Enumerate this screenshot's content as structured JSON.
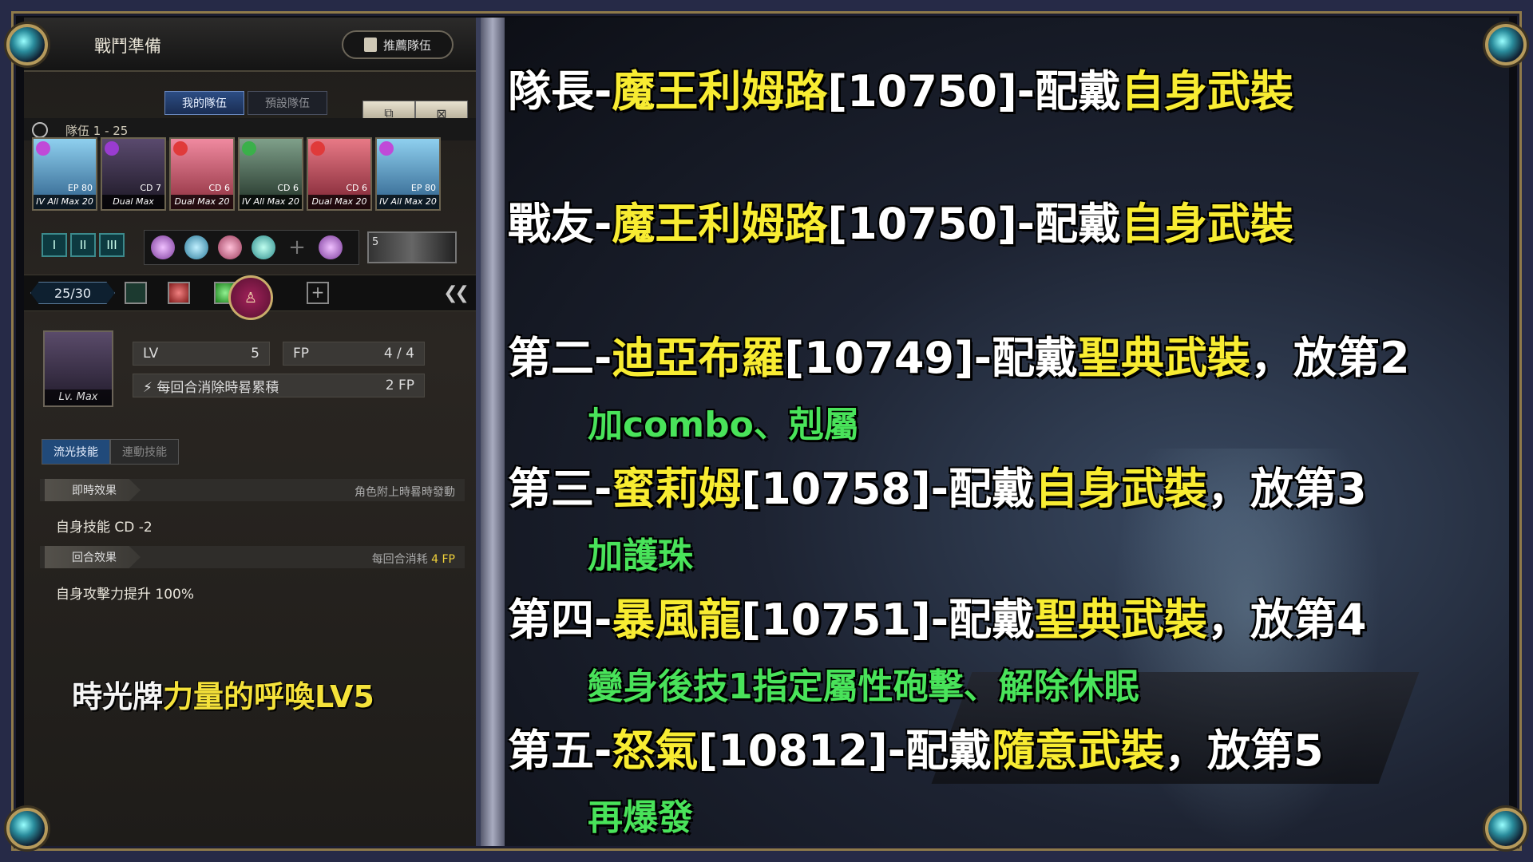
{
  "panel": {
    "title": "戰鬥準備",
    "recommend_button": "推薦隊伍",
    "tabs": [
      "我的隊伍",
      "預設隊伍"
    ],
    "team_label": "隊伍 1 - 25",
    "team_count": "25/30",
    "cards": [
      {
        "tag": "All Max",
        "level": "20",
        "info": "EP 80",
        "tier": "IV",
        "color": "#4a93c8"
      },
      {
        "tag": "Dual Max",
        "level": "",
        "info": "CD 7",
        "tier": "",
        "color": "#3a3246"
      },
      {
        "tag": "Dual Max",
        "level": "20",
        "info": "CD 6",
        "tier": "",
        "color": "#c05a6a"
      },
      {
        "tag": "All Max",
        "level": "20",
        "info": "CD 6",
        "tier": "IV",
        "color": "#3c5a48"
      },
      {
        "tag": "Dual Max",
        "level": "20",
        "info": "CD 6",
        "tier": "",
        "color": "#b84a55"
      },
      {
        "tag": "All Max",
        "level": "20",
        "info": "EP 80",
        "tier": "IV",
        "color": "#4a93c8"
      }
    ],
    "roman": [
      "I",
      "II",
      "III"
    ],
    "minipic_label": "5",
    "stats": {
      "lv_label": "LV",
      "lv_value": "5",
      "fp_label": "FP",
      "fp_value": "4 / 4",
      "passive": "每回合消除時晷累積",
      "passive_cost": "2 FP"
    },
    "portrait_label": "Lv. Max",
    "skill_tabs": [
      "流光技能",
      "連動技能"
    ],
    "effects": [
      {
        "tag": "即時效果",
        "right": "角色附上時晷時發動",
        "text": "自身技能 CD -2"
      },
      {
        "tag": "回合效果",
        "right": "每回合消耗",
        "right_hl": "4 FP",
        "text": "自身攻擊力提升 100%"
      }
    ],
    "caption_white": "時光牌",
    "caption_yellow": "力量的呼喚LV5"
  },
  "lines": [
    {
      "w1": "隊長-",
      "y1": "魔王利姆路",
      "w2": "[10750]-配戴",
      "y2": "自身武裝",
      "w3": ""
    },
    {
      "w1": "戰友-",
      "y1": "魔王利姆路",
      "w2": "[10750]-配戴",
      "y2": "自身武裝",
      "w3": ""
    },
    {
      "w1": "第二-",
      "y1": "迪亞布羅",
      "w2": "[10749]-配戴",
      "y2": "聖典武裝",
      "w3": "，放第2"
    },
    {
      "w1": "第三-",
      "y1": "蜜莉姆",
      "w2": "[10758]-配戴",
      "y2": "自身武裝",
      "w3": "，放第3"
    },
    {
      "w1": "第四-",
      "y1": "暴風龍",
      "w2": "[10751]-配戴",
      "y2": "聖典武裝",
      "w3": "，放第4"
    },
    {
      "w1": "第五-",
      "y1": "怒氣",
      "w2": "[10812]-配戴",
      "y2": "隨意武裝",
      "w3": "，放第5"
    }
  ],
  "subs": [
    "加combo、剋屬",
    "加護珠",
    "變身後技1指定屬性砲擊、解除休眠",
    "再爆發"
  ],
  "colors": {
    "yellow": "#f8ec32",
    "green": "#49e35a"
  }
}
